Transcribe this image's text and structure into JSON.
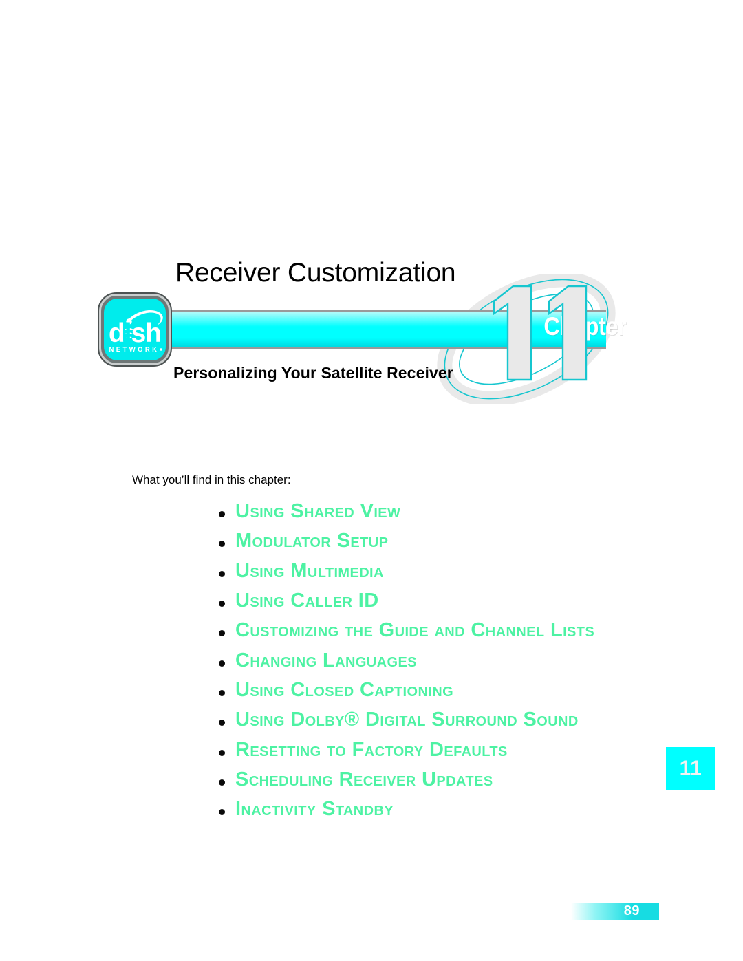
{
  "document": {
    "page_number": "89"
  },
  "chapter": {
    "title": "Receiver Customization",
    "banner_label": "Chapter",
    "number": "11",
    "number_graphic": "11",
    "subtitle": "Personalizing Your Satellite Receiver",
    "tab_number": "11"
  },
  "logo": {
    "wordmark": "dish",
    "subtext": "N E T W O R K",
    "registered_mark": "®"
  },
  "body": {
    "intro": "What you’ll find in this chapter:",
    "toc": [
      "Using Shared View",
      "Modulator Setup",
      "Using Multimedia",
      "Using Caller ID",
      "Customizing the Guide and Channel Lists",
      "Changing Languages",
      "Using Closed Captioning",
      "Using Dolby® Digital Surround Sound",
      "Resetting to Factory Defaults",
      "Scheduling Receiver Updates",
      "Inactivity Standby"
    ]
  },
  "colors": {
    "cyan": "#00ffff",
    "banner_cyan": "#00ffff",
    "toc_green": "#4df2a3",
    "number_gray": "#e9e9e9",
    "number_outline_teal": "#16c6cf",
    "footer_cyan": "#17dce2",
    "text_black": "#000000"
  }
}
